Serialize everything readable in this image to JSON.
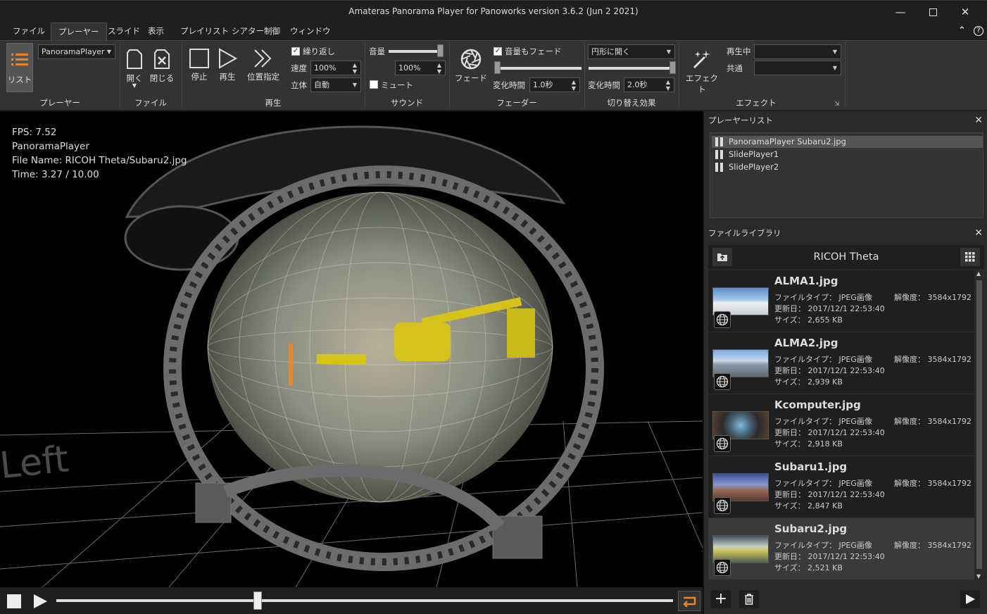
{
  "window": {
    "title": "Amateras Panorama Player for Panoworks version 3.6.2 (Jun  2 2021)"
  },
  "menu": {
    "items": [
      "ファイル",
      "プレーヤー",
      "スライド",
      "表示",
      "プレイリスト",
      "シアター制御",
      "ウィンドウ"
    ],
    "active": "プレーヤー"
  },
  "ribbon": {
    "player": {
      "list_label": "リスト",
      "player_select": "PanoramaPlayer",
      "group_label": "プレーヤー"
    },
    "file": {
      "open_label": "開く",
      "close_label": "閉じる",
      "group_label": "ファイル"
    },
    "playback": {
      "stop_label": "停止",
      "play_label": "再生",
      "seek_label": "位置指定",
      "loop_label": "繰り返し",
      "loop_checked": true,
      "speed_label": "速度",
      "speed_value": "100%",
      "stereo_label": "立体",
      "stereo_value": "自動",
      "group_label": "再生"
    },
    "sound": {
      "volume_label": "音量",
      "volume_value": "100%",
      "volume_level": 1.0,
      "mute_label": "ミュート",
      "mute_checked": false,
      "group_label": "サウンド"
    },
    "fader": {
      "fade_label": "フェード",
      "fade_volume_label": "音量もフェード",
      "fade_volume_checked": true,
      "duration_label": "変化時間",
      "duration_value": "1.0秒",
      "fade_level": 0.0,
      "group_label": "フェーダー"
    },
    "transition": {
      "mode_value": "円形に開く",
      "duration_label": "変化時間",
      "duration_value": "2.0秒",
      "transition_level": 1.0,
      "group_label": "切り替え効果"
    },
    "effect": {
      "effect_label": "エフェクト",
      "playing_label": "再生中",
      "common_label": "共通",
      "group_label": "エフェクト"
    }
  },
  "viewport": {
    "fps": "FPS: 7.52",
    "player": "PanoramaPlayer",
    "file_name": "File Name: RICOH Theta/Subaru2.jpg",
    "time": "Time: 3.27 / 10.00",
    "floor_text": "Left"
  },
  "transport": {
    "progress": 0.327
  },
  "player_list": {
    "title": "プレーヤーリスト",
    "items": [
      "PanoramaPlayer  Subaru2.jpg",
      "SlidePlayer1",
      "SlidePlayer2"
    ],
    "selected": 0
  },
  "library": {
    "title": "ファイルライブラリ",
    "folder": "RICOH Theta",
    "type_label": "ファイルタイプ：",
    "date_label": "更新日：",
    "size_label": "サイズ：",
    "res_label": "解像度：",
    "items": [
      {
        "name": "ALMA1.jpg",
        "type": "JPEG画像",
        "date": "2017/12/1 22:53:40",
        "size": "2,655 KB",
        "res": "3584x1792"
      },
      {
        "name": "ALMA2.jpg",
        "type": "JPEG画像",
        "date": "2017/12/1 22:53:40",
        "size": "2,939 KB",
        "res": "3584x1792"
      },
      {
        "name": "Kcomputer.jpg",
        "type": "JPEG画像",
        "date": "2017/12/1 22:53:40",
        "size": "2,918 KB",
        "res": "3584x1792"
      },
      {
        "name": "Subaru1.jpg",
        "type": "JPEG画像",
        "date": "2017/12/1 22:53:40",
        "size": "2,847 KB",
        "res": "3584x1792"
      },
      {
        "name": "Subaru2.jpg",
        "type": "JPEG画像",
        "date": "2017/12/1 22:53:40",
        "size": "2,521 KB",
        "res": "3584x1792"
      }
    ],
    "selected": 4
  },
  "colors": {
    "accent": "#e8862a",
    "background": "#1f1f1f",
    "ribbon": "#333333"
  }
}
